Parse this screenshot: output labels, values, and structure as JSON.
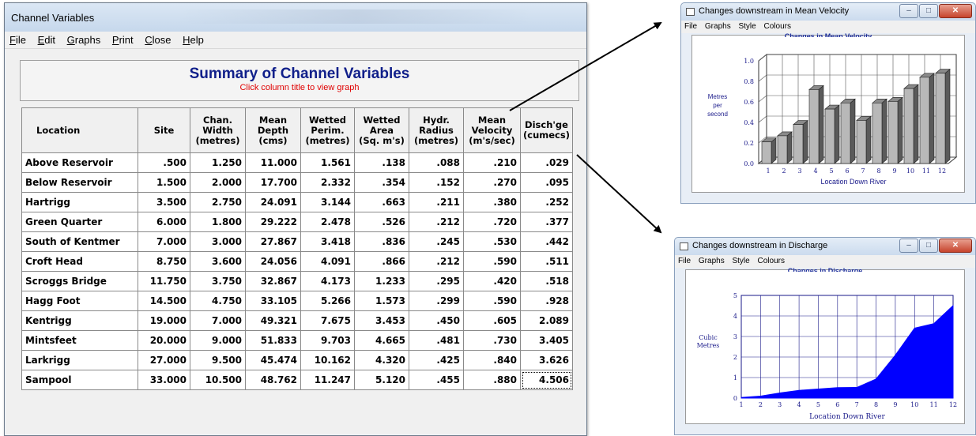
{
  "main_window": {
    "title": "Channel Variables",
    "menu": [
      "File",
      "Edit",
      "Graphs",
      "Print",
      "Close",
      "Help"
    ],
    "heading": "Summary of Channel Variables",
    "subheading": "Click column title to view graph",
    "columns": [
      "Location",
      "Site",
      "Chan.\nWidth\n(metres)",
      "Mean\nDepth\n(cms)",
      "Wetted\nPerim.\n(metres)",
      "Wetted\nArea\n(Sq. m's)",
      "Hydr.\nRadius\n(metres)",
      "Mean\nVelocity\n(m's/sec)",
      "Disch'ge\n(cumecs)"
    ],
    "rows": [
      [
        "Above Reservoir",
        ".500",
        "1.250",
        "11.000",
        "1.561",
        ".138",
        ".088",
        ".210",
        ".029"
      ],
      [
        "Below Reservoir",
        "1.500",
        "2.000",
        "17.700",
        "2.332",
        ".354",
        ".152",
        ".270",
        ".095"
      ],
      [
        "Hartrigg",
        "3.500",
        "2.750",
        "24.091",
        "3.144",
        ".663",
        ".211",
        ".380",
        ".252"
      ],
      [
        "Green Quarter",
        "6.000",
        "1.800",
        "29.222",
        "2.478",
        ".526",
        ".212",
        ".720",
        ".377"
      ],
      [
        "South of Kentmer",
        "7.000",
        "3.000",
        "27.867",
        "3.418",
        ".836",
        ".245",
        ".530",
        ".442"
      ],
      [
        "Croft Head",
        "8.750",
        "3.600",
        "24.056",
        "4.091",
        ".866",
        ".212",
        ".590",
        ".511"
      ],
      [
        "Scroggs Bridge",
        "11.750",
        "3.750",
        "32.867",
        "4.173",
        "1.233",
        ".295",
        ".420",
        ".518"
      ],
      [
        "Hagg Foot",
        "14.500",
        "4.750",
        "33.105",
        "5.266",
        "1.573",
        ".299",
        ".590",
        ".928"
      ],
      [
        "Kentrigg",
        "19.000",
        "7.000",
        "49.321",
        "7.675",
        "3.453",
        ".450",
        ".605",
        "2.089"
      ],
      [
        "Mintsfeet",
        "20.000",
        "9.000",
        "51.833",
        "9.703",
        "4.665",
        ".481",
        ".730",
        "3.405"
      ],
      [
        "Larkrigg",
        "27.000",
        "9.500",
        "45.474",
        "10.162",
        "4.320",
        ".425",
        ".840",
        "3.626"
      ],
      [
        "Sampool",
        "33.000",
        "10.500",
        "48.762",
        "11.247",
        "5.120",
        ".455",
        ".880",
        "4.506"
      ]
    ]
  },
  "velocity_window": {
    "title": "Changes downstream in Mean Velocity",
    "menu": [
      "File",
      "Graphs",
      "Style",
      "Colours"
    ],
    "chart_heading": "Changes in Mean Velocity",
    "ylabel": "Metres\nper\nsecond",
    "xlabel": "Location Down River",
    "bar_color": "#b8b8b8",
    "grid_color": "#1a1a8a"
  },
  "discharge_window": {
    "title": "Changes downstream in Discharge",
    "menu": [
      "File",
      "Graphs",
      "Style",
      "Colours"
    ],
    "chart_heading": "Changes in Discharge",
    "ylabel": "Cubic\nMetres",
    "xlabel": "Location Down River",
    "fill_color": "#0000ff",
    "grid_color": "#1a1a8a"
  },
  "chart_data": [
    {
      "type": "bar",
      "title": "Changes in Mean Velocity",
      "xlabel": "Location Down River",
      "ylabel": "Metres per second",
      "categories": [
        "1",
        "2",
        "3",
        "4",
        "5",
        "6",
        "7",
        "8",
        "9",
        "10",
        "11",
        "12"
      ],
      "values": [
        0.21,
        0.27,
        0.38,
        0.72,
        0.53,
        0.59,
        0.42,
        0.59,
        0.605,
        0.73,
        0.84,
        0.88
      ],
      "yticks": [
        "0.0",
        "0.2",
        "0.4",
        "0.6",
        "0.8",
        "1.0"
      ],
      "ylim": [
        0,
        1.0
      ],
      "grid": true
    },
    {
      "type": "area",
      "title": "Changes in Discharge",
      "xlabel": "Location Down River",
      "ylabel": "Cubic Metres",
      "x": [
        1,
        2,
        3,
        4,
        5,
        6,
        7,
        8,
        9,
        10,
        11,
        12
      ],
      "values": [
        0.029,
        0.095,
        0.252,
        0.377,
        0.442,
        0.511,
        0.518,
        0.928,
        2.089,
        3.405,
        3.626,
        4.506
      ],
      "xticks": [
        "1",
        "2",
        "3",
        "4",
        "5",
        "6",
        "7",
        "8",
        "9",
        "10",
        "11",
        "12"
      ],
      "yticks": [
        "0",
        "1",
        "2",
        "3",
        "4",
        "5"
      ],
      "ylim": [
        0,
        5
      ],
      "grid": true
    }
  ]
}
